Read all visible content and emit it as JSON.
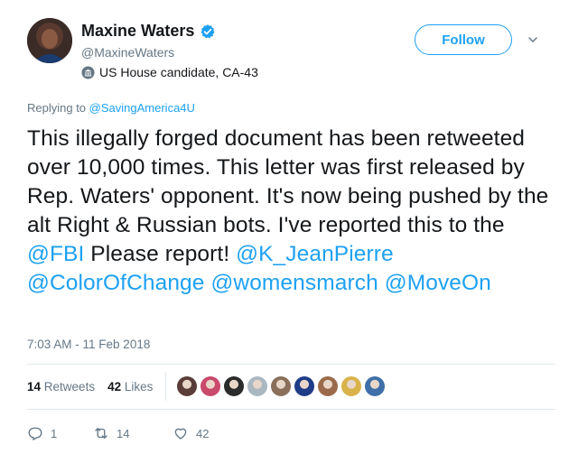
{
  "author": {
    "display_name": "Maxine Waters",
    "handle": "@MaxineWaters",
    "label": "US House candidate, CA-43",
    "verified": true
  },
  "follow_button": {
    "label": "Follow"
  },
  "reply_context": {
    "prefix": "Replying to",
    "mention": "@SavingAmerica4U"
  },
  "tweet": {
    "text_1": "This illegally forged document has been retweeted over 10,000 times. This letter was first released by Rep. Waters' opponent. It's now being pushed by the alt Right & Russian bots. I've reported this to the ",
    "mention_fbi": "@FBI",
    "text_2": " Please report! ",
    "mention_jp": "@K_JeanPierre",
    "mention_coc": "@ColorOfChange",
    "mention_wm": "@womensmarch",
    "mention_mo": "@MoveOn"
  },
  "timestamp": "7:03 AM - 11 Feb 2018",
  "stats": {
    "retweets_count": "14",
    "retweets_label": "Retweets",
    "likes_count": "42",
    "likes_label": "Likes"
  },
  "liker_avatars": [
    {
      "name": "liker-avatar-1",
      "color": "#5a3d38"
    },
    {
      "name": "liker-avatar-2",
      "color": "#c94a6b"
    },
    {
      "name": "liker-avatar-3",
      "color": "#2b2b2b"
    },
    {
      "name": "liker-avatar-4",
      "color": "#aab8c2"
    },
    {
      "name": "liker-avatar-5",
      "color": "#8a6f5a"
    },
    {
      "name": "liker-avatar-6",
      "color": "#1f3c88"
    },
    {
      "name": "liker-avatar-7",
      "color": "#9b6a4a"
    },
    {
      "name": "liker-avatar-8",
      "color": "#d9b24a"
    },
    {
      "name": "liker-avatar-9",
      "color": "#3f6fa8"
    }
  ],
  "actions": {
    "reply_count": "1",
    "retweet_count": "14",
    "like_count": "42"
  },
  "colors": {
    "accent": "#1da1f2",
    "muted": "#657786",
    "text": "#14171a"
  }
}
